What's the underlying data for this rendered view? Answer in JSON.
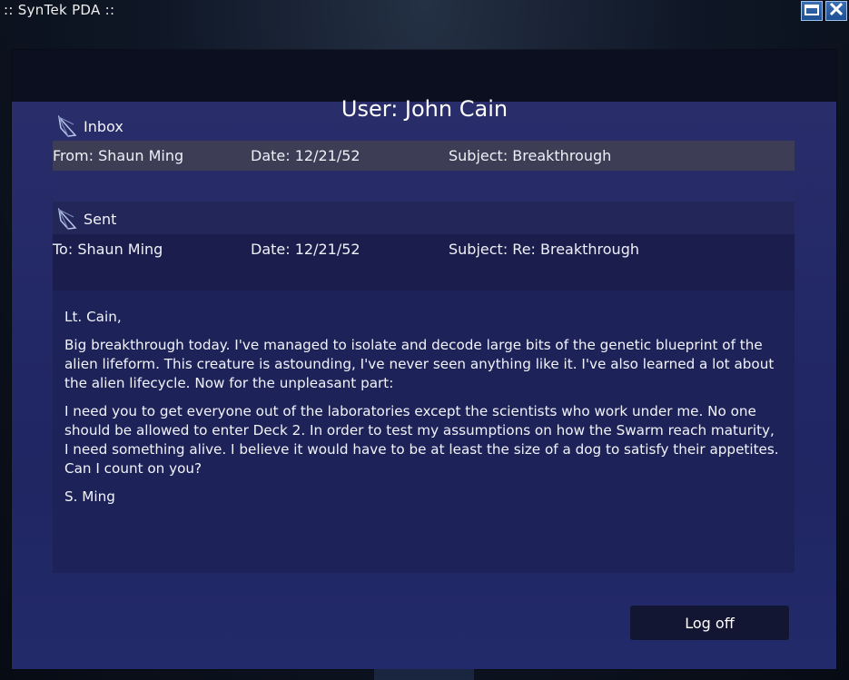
{
  "window": {
    "title": ":: SynTek PDA ::",
    "maximize_icon": "maximize-icon",
    "close_icon": "close-icon",
    "accent": "#2a5fa6"
  },
  "header": {
    "user_title": "User: John Cain"
  },
  "inbox": {
    "label": "Inbox",
    "icon": "mail-feather-icon",
    "message": {
      "from": "From: Shaun Ming",
      "date": "Date: 12/21/52",
      "subject": "Subject: Breakthrough"
    }
  },
  "sent": {
    "label": "Sent",
    "icon": "mail-feather-icon",
    "message": {
      "to": "To: Shaun Ming",
      "date": "Date: 12/21/52",
      "subject": "Subject: Re: Breakthrough"
    }
  },
  "message_body": {
    "greeting": "Lt. Cain,",
    "paragraph1": "Big breakthrough today.  I've managed to isolate and decode large bits of the genetic blueprint of the alien lifeform.  This creature is astounding, I've never seen anything like it.  I've also learned a lot about the alien lifecycle.  Now for the unpleasant part:",
    "paragraph2": "I need you to get everyone out of the laboratories except the scientists who work under me.  No one should be allowed to enter Deck 2.  In order to test my assumptions on how the Swarm reach maturity, I need something alive.  I believe it would have to be at least the size of a dog to satisfy their appetites.  Can I count on you?",
    "signature": "S. Ming"
  },
  "actions": {
    "logoff_label": "Log off"
  }
}
